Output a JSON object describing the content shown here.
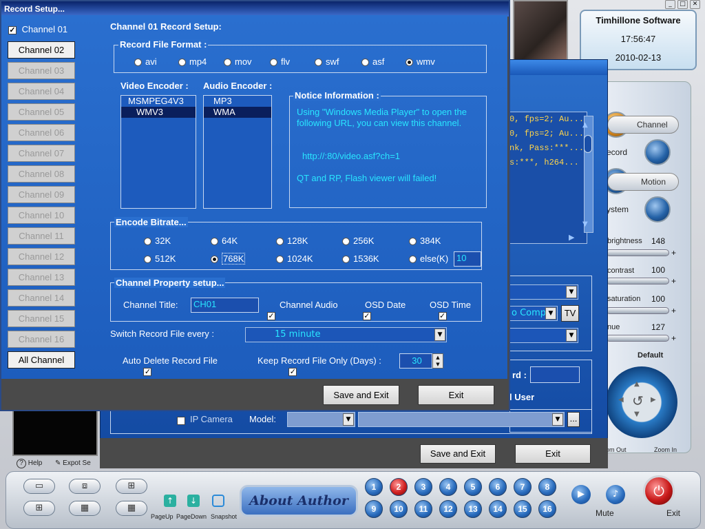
{
  "app": {
    "vendor": "Timhillone Software",
    "time": "17:56:47",
    "date": "2010-02-13",
    "min_btn": "_",
    "max_btn": "□",
    "close_btn": "✕"
  },
  "right_panel": {
    "channel_label": "Channel",
    "record_label": "ecord",
    "motion_label": "Motion",
    "system_label": "ystem",
    "brightness_label": "brightness",
    "brightness_value": "148",
    "contrast_label": "contrast",
    "contrast_value": "100",
    "saturation_label": "saturation",
    "saturation_value": "100",
    "hue_label": "nue",
    "hue_value": "127",
    "plus": "+",
    "default_label": "Default",
    "zoom_out": "om Out",
    "zoom_in": "Zoom In"
  },
  "dialog2": {
    "log_lines": [
      "0, fps=2;  Au...",
      "0, fps=2;  Au...",
      "nk, Pass:***...",
      "s:***, h264..."
    ],
    "password_label": "rd :",
    "user_label": "l User",
    "combo_text": "o Compo",
    "tv_button": "TV",
    "ip_camera_label": "IP Camera",
    "model_label": "Model:",
    "browse_button": "...",
    "save_exit": "Save and Exit",
    "exit": "Exit"
  },
  "dialog": {
    "title": "Record Setup...",
    "channels": [
      {
        "label": "Channel 01",
        "state": "checked"
      },
      {
        "label": "Channel 02",
        "state": "active"
      },
      {
        "label": "Channel 03",
        "state": "disabled"
      },
      {
        "label": "Channel 04",
        "state": "disabled"
      },
      {
        "label": "Channel 05",
        "state": "disabled"
      },
      {
        "label": "Channel 06",
        "state": "disabled"
      },
      {
        "label": "Channel 07",
        "state": "disabled"
      },
      {
        "label": "Channel 08",
        "state": "disabled"
      },
      {
        "label": "Channel 09",
        "state": "disabled"
      },
      {
        "label": "Channel 10",
        "state": "disabled"
      },
      {
        "label": "Channel 11",
        "state": "disabled"
      },
      {
        "label": "Channel 12",
        "state": "disabled"
      },
      {
        "label": "Channel 13",
        "state": "disabled"
      },
      {
        "label": "Channel 14",
        "state": "disabled"
      },
      {
        "label": "Channel 15",
        "state": "disabled"
      },
      {
        "label": "Channel 16",
        "state": "disabled"
      },
      {
        "label": "All Channel",
        "state": "active"
      }
    ],
    "setup_title": "Channel 01 Record Setup:",
    "format_group": "Record File Format :",
    "formats": [
      "avi",
      "mp4",
      "mov",
      "flv",
      "swf",
      "asf",
      "wmv"
    ],
    "selected_format": "wmv",
    "video_encoder_label": "Video Encoder :",
    "audio_encoder_label": "Audio Encoder :",
    "video_encoders": [
      "MSMPEG4V3",
      "WMV3"
    ],
    "selected_video_encoder": "WMV3",
    "audio_encoders": [
      "MP3",
      "WMA"
    ],
    "selected_audio_encoder": "WMA",
    "notice_label": "Notice Information :",
    "notice_text1": "Using \"Windows Media Player\" to open the following URL, you can view this channel.",
    "notice_url": "http://:80/video.asf?ch=1",
    "notice_text2": "QT and RP, Flash viewer will failed!",
    "bitrate_group": "Encode Bitrate...",
    "bitrates": [
      "32K",
      "64K",
      "128K",
      "256K",
      "384K",
      "512K",
      "768K",
      "1024K",
      "1536K",
      "else(K)"
    ],
    "selected_bitrate": "768K",
    "else_value": "10",
    "property_group": "Channel Property setup...",
    "channel_title_label": "Channel Title:",
    "channel_title_value": "CH01",
    "channel_audio": "Channel Audio",
    "osd_date": "OSD Date",
    "osd_time": "OSD Time",
    "switch_label": "Switch Record File every :",
    "switch_value": "15 minute",
    "auto_delete": "Auto Delete Record File",
    "keep_label": "Keep Record File Only (Days) :",
    "keep_value": "30",
    "save_exit": "Save and Exit",
    "exit": "Exit",
    "check_mark": "✓"
  },
  "bottom": {
    "help": "Help",
    "export": "Expot Se",
    "page_up": "PageUp",
    "page_down": "PageDown",
    "snapshot": "Snapshot",
    "about": "About  Author",
    "numbers": [
      "1",
      "2",
      "3",
      "4",
      "5",
      "6",
      "7",
      "8",
      "9",
      "10",
      "11",
      "12",
      "13",
      "14",
      "15",
      "16"
    ],
    "mute": "Mute",
    "exit": "Exit"
  }
}
